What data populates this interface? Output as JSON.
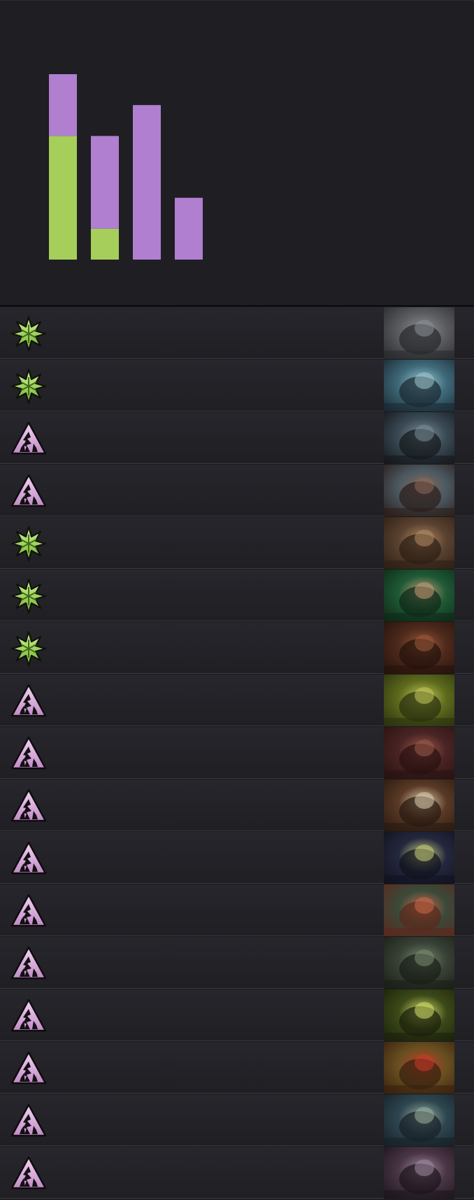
{
  "colors": {
    "background": "#1e1e22",
    "creature": "#a6ce5a",
    "spell": "#b07fd0",
    "row_divider": "#3a3a40"
  },
  "chart_data": {
    "type": "bar",
    "stacked": true,
    "title": "",
    "xlabel": "",
    "ylabel": "",
    "categories": [
      "",
      "",
      "",
      ""
    ],
    "series": [
      {
        "color": "#a6ce5a",
        "icon": "creature-icon",
        "values": [
          4,
          1,
          0,
          0
        ]
      },
      {
        "color": "#b07fd0",
        "icon": "spell-icon",
        "values": [
          2,
          3,
          5,
          2
        ]
      }
    ],
    "ylim": [
      0,
      6
    ],
    "grid": false,
    "legend": "none"
  },
  "cards": [
    {
      "type_icon": "creature-icon",
      "art": {
        "bg": "#5a5c60",
        "accent": "#2a2b2f",
        "highlight": "#8c8f95"
      }
    },
    {
      "type_icon": "creature-icon",
      "art": {
        "bg": "#3f6a7a",
        "accent": "#1b2a33",
        "highlight": "#9cc7d0"
      }
    },
    {
      "type_icon": "spell-icon",
      "art": {
        "bg": "#3a4a55",
        "accent": "#16191d",
        "highlight": "#7a8d96"
      }
    },
    {
      "type_icon": "spell-icon",
      "art": {
        "bg": "#4c5a62",
        "accent": "#2b1f1d",
        "highlight": "#8a6a5a"
      }
    },
    {
      "type_icon": "creature-icon",
      "art": {
        "bg": "#5a4230",
        "accent": "#2e2016",
        "highlight": "#b38b62"
      }
    },
    {
      "type_icon": "creature-icon",
      "art": {
        "bg": "#1e5a35",
        "accent": "#0f2a18",
        "highlight": "#c79a78"
      }
    },
    {
      "type_icon": "creature-icon",
      "art": {
        "bg": "#4e2a1c",
        "accent": "#26130c",
        "highlight": "#9a5a3a"
      }
    },
    {
      "type_icon": "spell-icon",
      "art": {
        "bg": "#5e6a1c",
        "accent": "#2c3310",
        "highlight": "#c2c85a"
      }
    },
    {
      "type_icon": "spell-icon",
      "art": {
        "bg": "#4a2424",
        "accent": "#2a1212",
        "highlight": "#9a5a4a"
      }
    },
    {
      "type_icon": "spell-icon",
      "art": {
        "bg": "#5a3a26",
        "accent": "#2a1a10",
        "highlight": "#e0cfb0"
      }
    },
    {
      "type_icon": "spell-icon",
      "art": {
        "bg": "#24283e",
        "accent": "#12131f",
        "highlight": "#c8d07a"
      }
    },
    {
      "type_icon": "spell-icon",
      "art": {
        "bg": "#3a4a3a",
        "accent": "#5a2a1e",
        "highlight": "#c86a48"
      }
    },
    {
      "type_icon": "spell-icon",
      "art": {
        "bg": "#394236",
        "accent": "#1a1f18",
        "highlight": "#7a8a70"
      }
    },
    {
      "type_icon": "spell-icon",
      "art": {
        "bg": "#3c4a18",
        "accent": "#1c220c",
        "highlight": "#d6e06a"
      }
    },
    {
      "type_icon": "spell-icon",
      "art": {
        "bg": "#6a5020",
        "accent": "#3a2210",
        "highlight": "#c83a2a"
      }
    },
    {
      "type_icon": "spell-icon",
      "art": {
        "bg": "#2e4650",
        "accent": "#182228",
        "highlight": "#9ab0a0"
      }
    },
    {
      "type_icon": "spell-icon",
      "art": {
        "bg": "#4a3646",
        "accent": "#1e161d",
        "highlight": "#a08aa0"
      }
    }
  ]
}
